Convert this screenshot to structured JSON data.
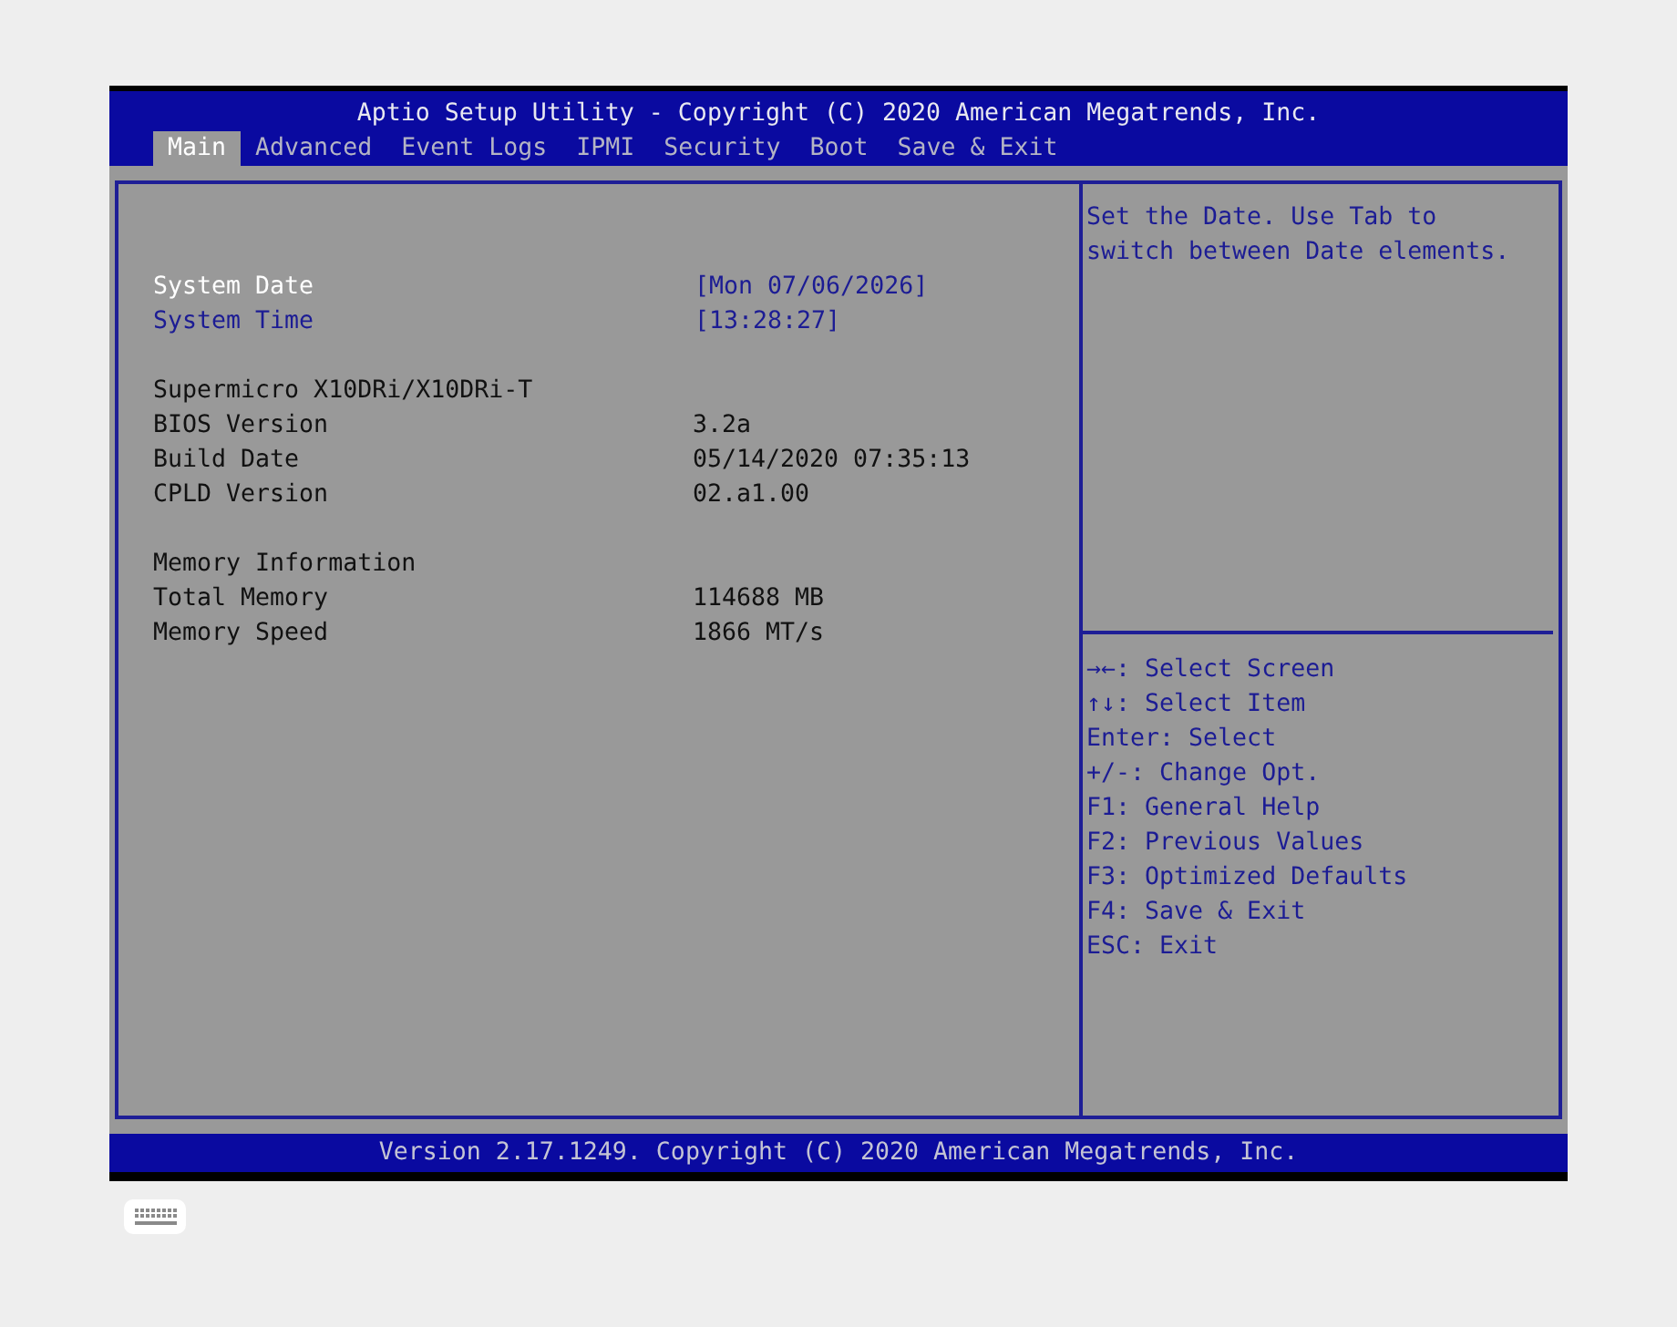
{
  "window": {
    "title": "Aptio Setup Utility - Copyright (C) 2020 American Megatrends, Inc."
  },
  "tabs": [
    {
      "label": "Main",
      "selected": true
    },
    {
      "label": "Advanced",
      "selected": false
    },
    {
      "label": "Event Logs",
      "selected": false
    },
    {
      "label": "IPMI",
      "selected": false
    },
    {
      "label": "Security",
      "selected": false
    },
    {
      "label": "Boot",
      "selected": false
    },
    {
      "label": "Save & Exit",
      "selected": false
    }
  ],
  "sections": [
    {
      "rows": [
        {
          "kind": "option",
          "label": "System Date",
          "value": "[Mon 07/06/2026]",
          "selected": true
        },
        {
          "kind": "option",
          "label": "System Time",
          "value": "[13:28:27]",
          "selected": false
        }
      ]
    },
    {
      "rows": [
        {
          "kind": "heading",
          "label": "Supermicro X10DRi/X10DRi-T"
        },
        {
          "kind": "info",
          "label": "BIOS Version",
          "value": "3.2a"
        },
        {
          "kind": "info",
          "label": "Build Date",
          "value": "05/14/2020 07:35:13"
        },
        {
          "kind": "info",
          "label": "CPLD Version",
          "value": "02.a1.00"
        }
      ]
    },
    {
      "rows": [
        {
          "kind": "heading",
          "label": "Memory Information"
        },
        {
          "kind": "info",
          "label": "Total Memory",
          "value": "114688 MB"
        },
        {
          "kind": "info",
          "label": "Memory Speed",
          "value": "1866 MT/s"
        }
      ]
    }
  ],
  "help": {
    "text": "Set the Date. Use Tab to switch between Date elements.",
    "keys": [
      "→←: Select Screen",
      "↑↓: Select Item",
      "Enter: Select",
      "+/-: Change Opt.",
      "F1: General Help",
      "F2: Previous Values",
      "F3: Optimized Defaults",
      "F4: Save & Exit",
      "ESC: Exit"
    ]
  },
  "status_bar": {
    "text": "Version 2.17.1249. Copyright (C) 2020 American Megatrends, Inc."
  }
}
